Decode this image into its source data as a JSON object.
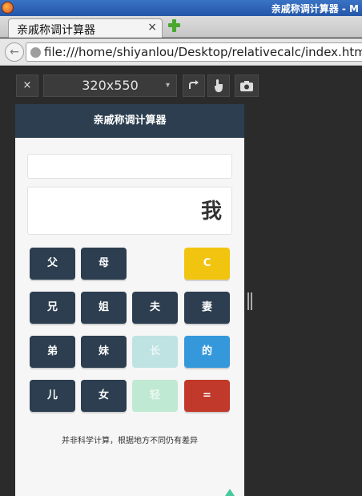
{
  "window": {
    "title": "亲戚称调计算器 - M"
  },
  "tab": {
    "title": "亲戚称调计算器",
    "close": "×"
  },
  "navbar": {
    "back": "←",
    "url": "file:///home/shiyanlou/Desktop/relativecalc/index.htm"
  },
  "devtools": {
    "close": "×",
    "size": "320x550",
    "chevron": "▾",
    "rotate_icon": "rotate-icon",
    "touch_icon": "touch-icon",
    "screenshot_icon": "camera-icon"
  },
  "app": {
    "title": "亲戚称调计算器",
    "formula": "",
    "result": "我",
    "keys": {
      "father": "父",
      "mother": "母",
      "clear": "C",
      "elder_brother": "兄",
      "elder_sister": "姐",
      "husband": "夫",
      "wife": "妻",
      "younger_brother": "弟",
      "younger_sister": "妹",
      "elder": "长",
      "of": "的",
      "son": "儿",
      "daughter": "女",
      "younger": "轻",
      "equals": "="
    },
    "note": "并非科学计算，根据地方不同仍有差异"
  },
  "colors": {
    "header": "#2c3e50",
    "key_dark": "#2c3e50",
    "key_clear": "#f1c40f",
    "key_of": "#3498db",
    "key_equals": "#c0392b"
  }
}
